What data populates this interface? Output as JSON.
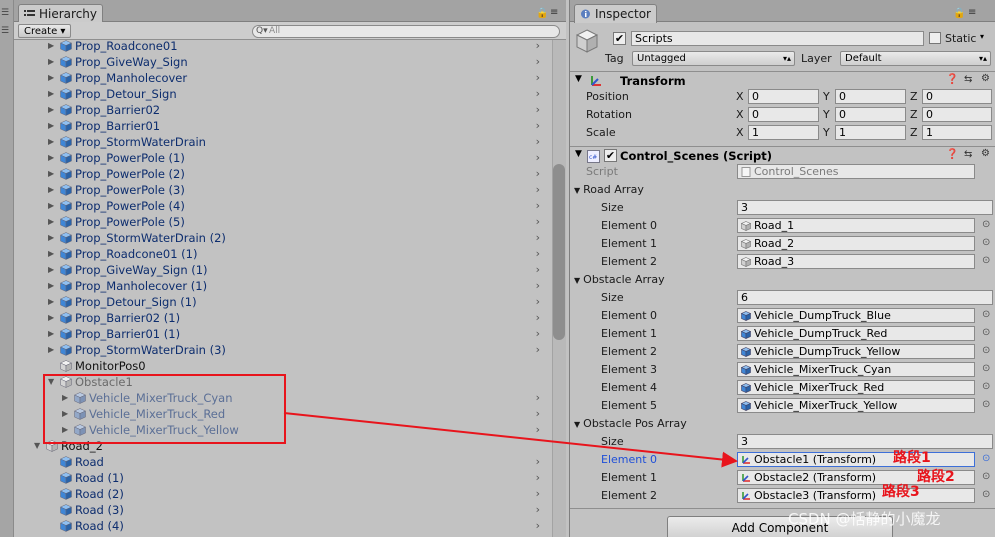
{
  "hierarchy": {
    "tab_label": "Hierarchy",
    "create_label": "Create",
    "search_placeholder": "All",
    "rows": [
      {
        "label": "Prop_Roadcone01",
        "style": "blue",
        "tri": "▶",
        "cube": "blue",
        "indent": 1
      },
      {
        "label": "Prop_GiveWay_Sign",
        "style": "blue",
        "tri": "▶",
        "cube": "blue",
        "indent": 1
      },
      {
        "label": "Prop_Manholecover",
        "style": "blue",
        "tri": "▶",
        "cube": "blue",
        "indent": 1
      },
      {
        "label": "Prop_Detour_Sign",
        "style": "blue",
        "tri": "▶",
        "cube": "blue",
        "indent": 1
      },
      {
        "label": "Prop_Barrier02",
        "style": "blue",
        "tri": "▶",
        "cube": "blue",
        "indent": 1
      },
      {
        "label": "Prop_Barrier01",
        "style": "blue",
        "tri": "▶",
        "cube": "blue",
        "indent": 1
      },
      {
        "label": "Prop_StormWaterDrain",
        "style": "blue",
        "tri": "▶",
        "cube": "blue",
        "indent": 1
      },
      {
        "label": "Prop_PowerPole (1)",
        "style": "blue",
        "tri": "▶",
        "cube": "blue",
        "indent": 1
      },
      {
        "label": "Prop_PowerPole (2)",
        "style": "blue",
        "tri": "▶",
        "cube": "blue",
        "indent": 1
      },
      {
        "label": "Prop_PowerPole (3)",
        "style": "blue",
        "tri": "▶",
        "cube": "blue",
        "indent": 1
      },
      {
        "label": "Prop_PowerPole (4)",
        "style": "blue",
        "tri": "▶",
        "cube": "blue",
        "indent": 1
      },
      {
        "label": "Prop_PowerPole (5)",
        "style": "blue",
        "tri": "▶",
        "cube": "blue",
        "indent": 1
      },
      {
        "label": "Prop_StormWaterDrain (2)",
        "style": "blue",
        "tri": "▶",
        "cube": "blue",
        "indent": 1
      },
      {
        "label": "Prop_Roadcone01 (1)",
        "style": "blue",
        "tri": "▶",
        "cube": "blue",
        "indent": 1
      },
      {
        "label": "Prop_GiveWay_Sign (1)",
        "style": "blue",
        "tri": "▶",
        "cube": "blue",
        "indent": 1
      },
      {
        "label": "Prop_Manholecover (1)",
        "style": "blue",
        "tri": "▶",
        "cube": "blue",
        "indent": 1
      },
      {
        "label": "Prop_Detour_Sign (1)",
        "style": "blue",
        "tri": "▶",
        "cube": "blue",
        "indent": 1
      },
      {
        "label": "Prop_Barrier02 (1)",
        "style": "blue",
        "tri": "▶",
        "cube": "blue",
        "indent": 1
      },
      {
        "label": "Prop_Barrier01 (1)",
        "style": "blue",
        "tri": "▶",
        "cube": "blue",
        "indent": 1
      },
      {
        "label": "Prop_StormWaterDrain (3)",
        "style": "blue",
        "tri": "▶",
        "cube": "blue",
        "indent": 1
      },
      {
        "label": "MonitorPos0",
        "style": "black",
        "tri": "",
        "cube": "white",
        "indent": 1
      },
      {
        "label": "Obstacle1",
        "style": "gray",
        "tri": "▼",
        "cube": "white",
        "indent": 1
      },
      {
        "label": "Vehicle_MixerTruck_Cyan",
        "style": "faded",
        "tri": "▶",
        "cube": "faded",
        "indent": 2
      },
      {
        "label": "Vehicle_MixerTruck_Red",
        "style": "faded",
        "tri": "▶",
        "cube": "faded",
        "indent": 2
      },
      {
        "label": "Vehicle_MixerTruck_Yellow",
        "style": "faded",
        "tri": "▶",
        "cube": "faded",
        "indent": 2
      },
      {
        "label": "Road_2",
        "style": "black",
        "tri": "▼",
        "cube": "white",
        "indent": 0
      },
      {
        "label": "Road",
        "style": "blue",
        "tri": "",
        "cube": "blue",
        "indent": 1
      },
      {
        "label": "Road (1)",
        "style": "blue",
        "tri": "",
        "cube": "blue",
        "indent": 1
      },
      {
        "label": "Road (2)",
        "style": "blue",
        "tri": "",
        "cube": "blue",
        "indent": 1
      },
      {
        "label": "Road (3)",
        "style": "blue",
        "tri": "",
        "cube": "blue",
        "indent": 1
      },
      {
        "label": "Road (4)",
        "style": "blue",
        "tri": "",
        "cube": "blue",
        "indent": 1
      }
    ]
  },
  "inspector": {
    "tab_label": "Inspector",
    "object_name": "Scripts",
    "static_label": "Static",
    "tag_label": "Tag",
    "tag_value": "Untagged",
    "layer_label": "Layer",
    "layer_value": "Default",
    "transform": {
      "title": "Transform",
      "rows": [
        {
          "label": "Position",
          "x": "0",
          "y": "0",
          "z": "0"
        },
        {
          "label": "Rotation",
          "x": "0",
          "y": "0",
          "z": "0"
        },
        {
          "label": "Scale",
          "x": "1",
          "y": "1",
          "z": "1"
        }
      ],
      "axis_x": "X",
      "axis_y": "Y",
      "axis_z": "Z"
    },
    "script_component": {
      "title": "Control_Scenes (Script)",
      "script_label": "Script",
      "script_value": "Control_Scenes",
      "road_array": {
        "label": "Road Array",
        "size_label": "Size",
        "size": "3",
        "elements": [
          {
            "label": "Element 0",
            "value": "Road_1"
          },
          {
            "label": "Element 1",
            "value": "Road_2"
          },
          {
            "label": "Element 2",
            "value": "Road_3"
          }
        ]
      },
      "obstacle_array": {
        "label": "Obstacle Array",
        "size_label": "Size",
        "size": "6",
        "elements": [
          {
            "label": "Element 0",
            "value": "Vehicle_DumpTruck_Blue"
          },
          {
            "label": "Element 1",
            "value": "Vehicle_DumpTruck_Red"
          },
          {
            "label": "Element 2",
            "value": "Vehicle_DumpTruck_Yellow"
          },
          {
            "label": "Element 3",
            "value": "Vehicle_MixerTruck_Cyan"
          },
          {
            "label": "Element 4",
            "value": "Vehicle_MixerTruck_Red"
          },
          {
            "label": "Element 5",
            "value": "Vehicle_MixerTruck_Yellow"
          }
        ]
      },
      "obstacle_pos_array": {
        "label": "Obstacle Pos Array",
        "size_label": "Size",
        "size": "3",
        "elements": [
          {
            "label": "Element 0",
            "value": "Obstacle1 (Transform)"
          },
          {
            "label": "Element 1",
            "value": "Obstacle2 (Transform)"
          },
          {
            "label": "Element 2",
            "value": "Obstacle3 (Transform)"
          }
        ]
      }
    },
    "add_component_label": "Add Component"
  },
  "annotations": {
    "segment1": "路段1",
    "segment2": "路段2",
    "segment3": "路段3",
    "color": "#e8141c"
  },
  "watermark": "CSDN @恬静的小魔龙",
  "colors": {
    "panel_bg": "#c2c2c2",
    "hierarchy_blue_text": "#0d2d6e",
    "selected_label": "#1f4fd8",
    "field_bg": "#e8e8e8"
  }
}
